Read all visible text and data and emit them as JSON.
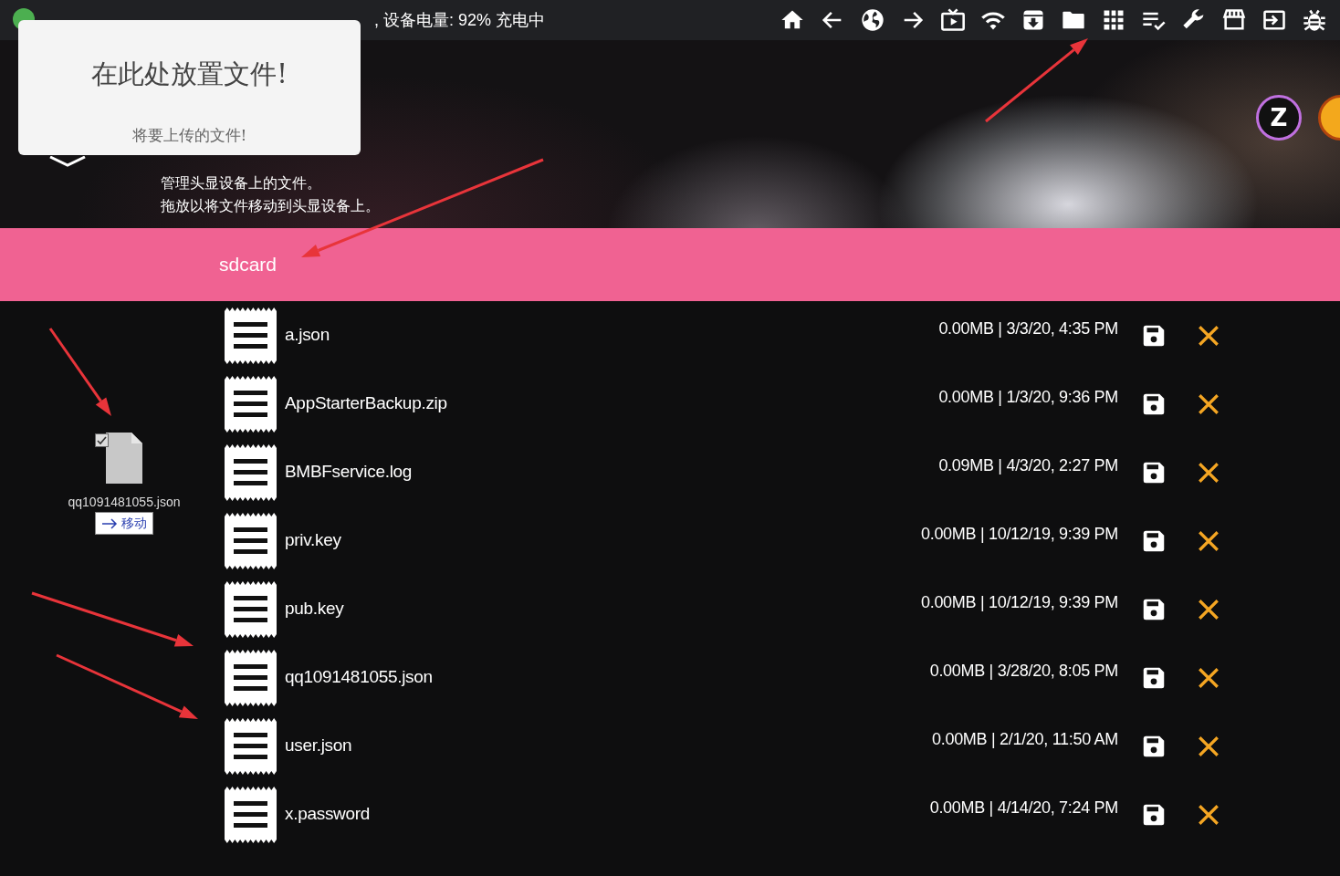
{
  "status_bar": {
    "connected": true,
    "text": ", 设备电量: 92% 充电中"
  },
  "header": {
    "avatar_letter": "Z",
    "description": [
      "管理头显设备上的文件。",
      "拖放以将文件移动到头显设备上。"
    ]
  },
  "drop_zone": {
    "title": "在此处放置文件!",
    "subtitle": "将要上传的文件!"
  },
  "path_bar": {
    "label": "sdcard"
  },
  "drag_item": {
    "checked": true,
    "name": "qq1091481055.json",
    "action": "移动"
  },
  "files": [
    {
      "name": "a.json",
      "meta": "0.00MB | 3/3/20, 4:35 PM"
    },
    {
      "name": "AppStarterBackup.zip",
      "meta": "0.00MB | 1/3/20, 9:36 PM"
    },
    {
      "name": "BMBFservice.log",
      "meta": "0.09MB | 4/3/20, 2:27 PM"
    },
    {
      "name": "priv.key",
      "meta": "0.00MB | 10/12/19, 9:39 PM"
    },
    {
      "name": "pub.key",
      "meta": "0.00MB | 10/12/19, 9:39 PM"
    },
    {
      "name": "qq1091481055.json",
      "meta": "0.00MB | 3/28/20, 8:05 PM"
    },
    {
      "name": "user.json",
      "meta": "0.00MB | 2/1/20, 11:50 AM"
    },
    {
      "name": "x.password",
      "meta": "0.00MB | 4/14/20, 7:24 PM"
    }
  ]
}
